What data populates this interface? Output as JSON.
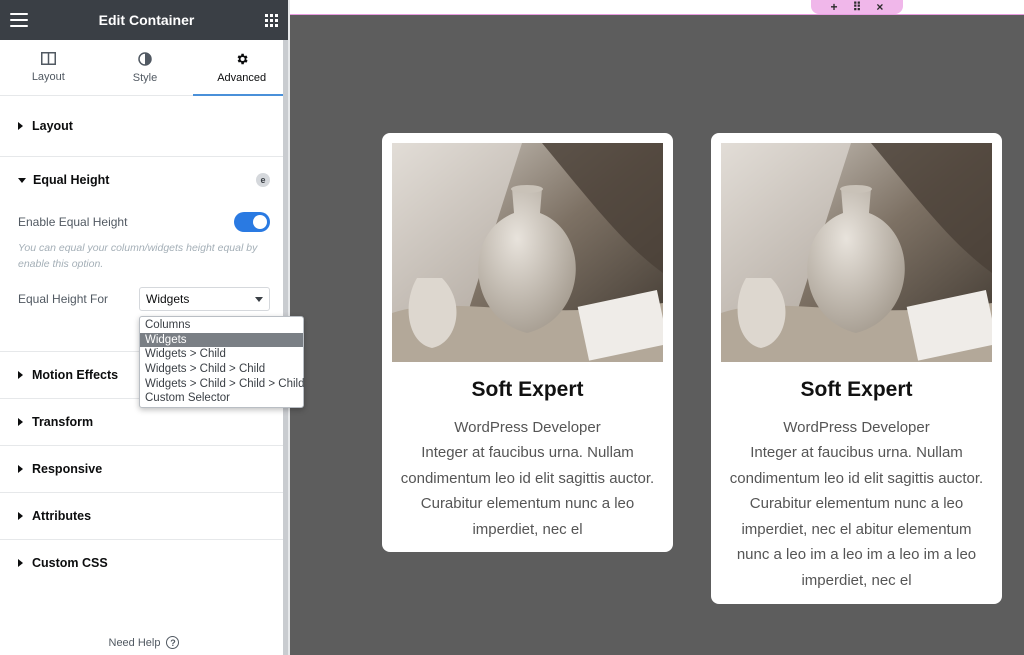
{
  "sidebar": {
    "title": "Edit Container",
    "tabs": [
      {
        "label": "Layout",
        "icon": "layout-icon",
        "active": false
      },
      {
        "label": "Style",
        "icon": "half-circle-icon",
        "active": false
      },
      {
        "label": "Advanced",
        "icon": "gear-icon",
        "active": true
      }
    ],
    "sections": {
      "layout": "Layout",
      "equal_height": "Equal Height",
      "motion_effects": "Motion Effects",
      "transform": "Transform",
      "responsive": "Responsive",
      "attributes": "Attributes",
      "custom_css": "Custom CSS"
    },
    "equal_height": {
      "badge": "e",
      "enable_label": "Enable Equal Height",
      "enabled": true,
      "help_text": "You can equal your column/widgets height equal by enable this option.",
      "for_label": "Equal Height For",
      "selected_value": "Widgets",
      "options": [
        "Columns",
        "Widgets",
        "Widgets > Child",
        "Widgets > Child > Child",
        "Widgets > Child > Child > Child",
        "Custom Selector"
      ]
    },
    "need_help": "Need Help",
    "accent_color": "#2a7ae2"
  },
  "canvas": {
    "handle_icons": [
      "+",
      "⠿",
      "×"
    ],
    "cards": [
      {
        "title": "Soft Expert",
        "role": "WordPress Developer",
        "body_lines": [
          "Integer at faucibus urna. Nullam",
          "condimentum leo id elit sagittis auctor.",
          "Curabitur elementum nunc a leo",
          "imperdiet, nec el"
        ]
      },
      {
        "title": "Soft Expert",
        "role": "WordPress Developer",
        "body_lines": [
          "Integer at faucibus urna. Nullam",
          "condimentum leo id elit sagittis auctor.",
          "Curabitur elementum nunc a leo",
          "imperdiet, nec el abitur elementum",
          "nunc a leo im a leo im a leo im a leo",
          "imperdiet, nec el"
        ]
      }
    ]
  }
}
